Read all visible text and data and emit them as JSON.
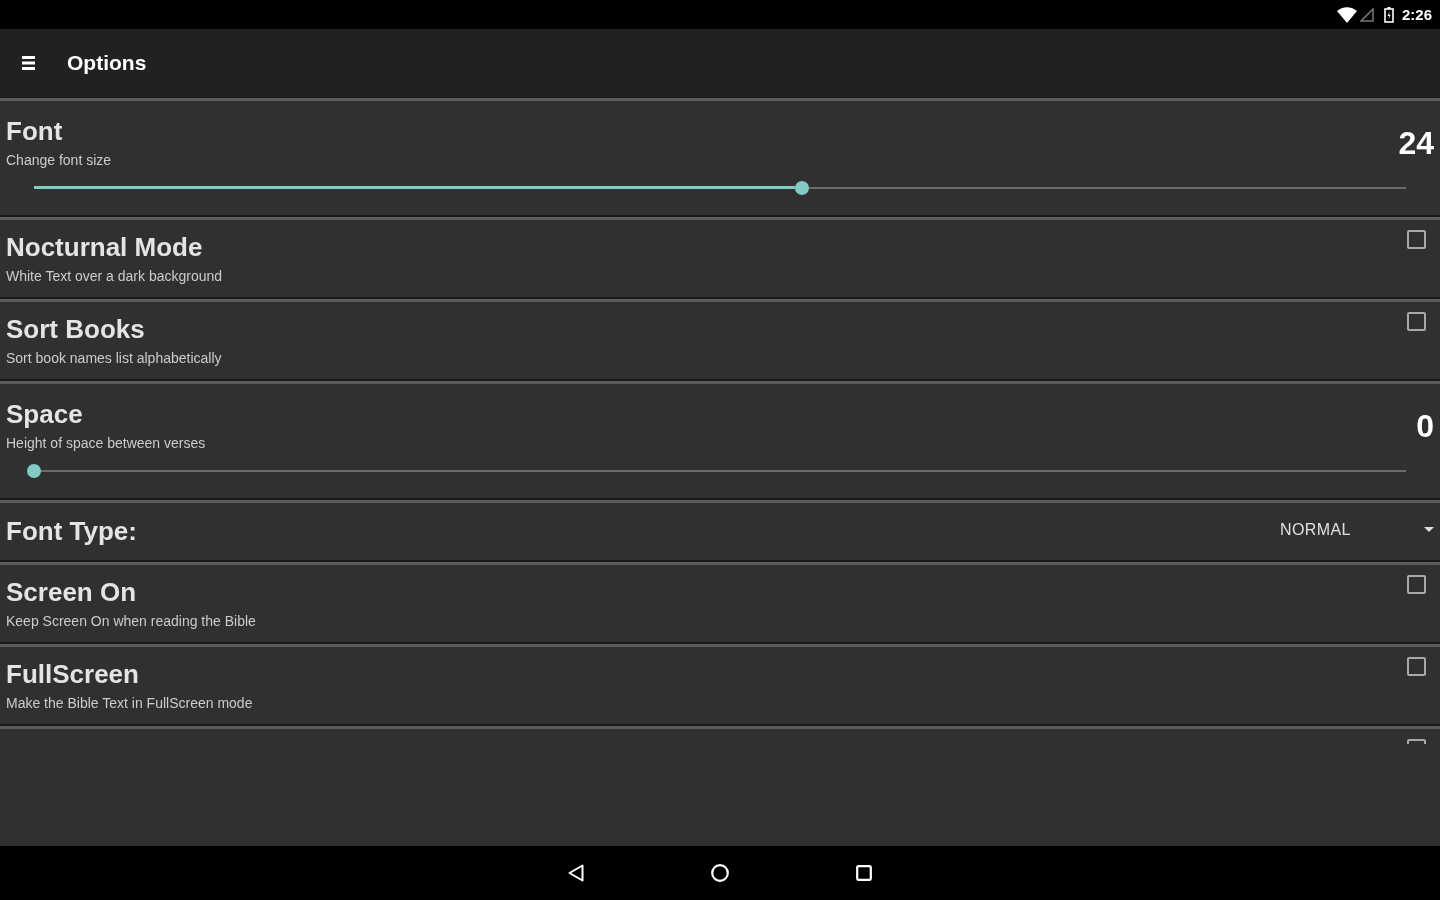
{
  "status_bar": {
    "time": "2:26"
  },
  "app_bar": {
    "title": "Options"
  },
  "settings": [
    {
      "kind": "slider",
      "title": "Font",
      "subtitle": "Change font size",
      "value": "24",
      "level": 0.56
    },
    {
      "kind": "checkbox",
      "title": "Nocturnal Mode",
      "subtitle": "White Text over a dark background",
      "checked": false
    },
    {
      "kind": "checkbox",
      "title": "Sort Books",
      "subtitle": "Sort book names list alphabetically",
      "checked": false
    },
    {
      "kind": "slider",
      "title": "Space",
      "subtitle": "Height of space between verses",
      "value": "0",
      "level": 0
    },
    {
      "kind": "dropdown",
      "title": "Font Type:",
      "value": "NORMAL"
    },
    {
      "kind": "checkbox",
      "title": "Screen On",
      "subtitle": "Keep Screen On when reading the Bible",
      "checked": false
    },
    {
      "kind": "checkbox",
      "title": "FullScreen",
      "subtitle": "Make the Bible Text in FullScreen mode",
      "checked": false
    },
    {
      "kind": "checkbox",
      "checked": false
    }
  ]
}
